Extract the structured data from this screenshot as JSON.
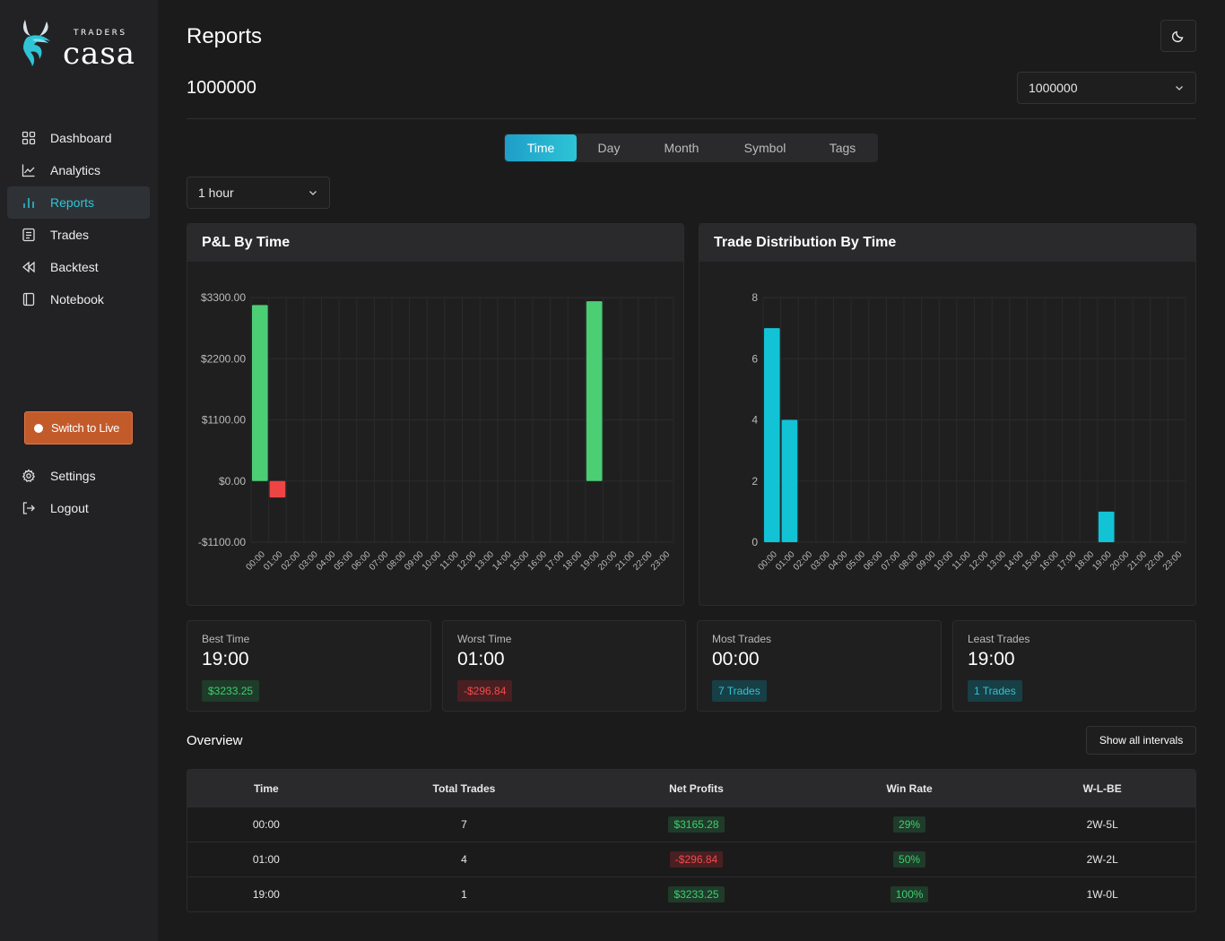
{
  "brand": {
    "traders": "TRADERS",
    "casa": "casa"
  },
  "sidebar": {
    "items": [
      {
        "label": "Dashboard",
        "icon": "dashboard-icon"
      },
      {
        "label": "Analytics",
        "icon": "analytics-icon"
      },
      {
        "label": "Reports",
        "icon": "reports-icon",
        "active": true
      },
      {
        "label": "Trades",
        "icon": "trades-icon"
      },
      {
        "label": "Backtest",
        "icon": "backtest-icon"
      },
      {
        "label": "Notebook",
        "icon": "notebook-icon"
      }
    ],
    "switch_label": "Switch to Live",
    "settings_label": "Settings",
    "logout_label": "Logout"
  },
  "header": {
    "title": "Reports",
    "account_title": "1000000",
    "account_select": "1000000"
  },
  "tabs": [
    "Time",
    "Day",
    "Month",
    "Symbol",
    "Tags"
  ],
  "interval_select": "1 hour",
  "pnl_chart_title": "P&L By Time",
  "dist_chart_title": "Trade Distribution By Time",
  "stats": [
    {
      "label": "Best Time",
      "value": "19:00",
      "badge": "$3233.25",
      "kind": "green"
    },
    {
      "label": "Worst Time",
      "value": "01:00",
      "badge": "-$296.84",
      "kind": "red"
    },
    {
      "label": "Most Trades",
      "value": "00:00",
      "badge": "7 Trades",
      "kind": "cyan"
    },
    {
      "label": "Least Trades",
      "value": "19:00",
      "badge": "1 Trades",
      "kind": "cyan"
    }
  ],
  "overview": {
    "title": "Overview",
    "show_all": "Show all intervals",
    "columns": [
      "Time",
      "Total Trades",
      "Net Profits",
      "Win Rate",
      "W-L-BE"
    ],
    "rows": [
      {
        "time": "00:00",
        "trades": "7",
        "profit": "$3165.28",
        "profit_kind": "green",
        "win": "29%",
        "wlbe": "2W-5L"
      },
      {
        "time": "01:00",
        "trades": "4",
        "profit": "-$296.84",
        "profit_kind": "red",
        "win": "50%",
        "wlbe": "2W-2L"
      },
      {
        "time": "19:00",
        "trades": "1",
        "profit": "$3233.25",
        "profit_kind": "green",
        "win": "100%",
        "wlbe": "1W-0L"
      }
    ]
  },
  "colors": {
    "accent": "#2ec4d6",
    "positive": "#4cce74",
    "negative": "#ef4444",
    "live": "#c35a2a"
  },
  "chart_data": [
    {
      "type": "bar",
      "title": "P&L By Time",
      "categories": [
        "00:00",
        "01:00",
        "02:00",
        "03:00",
        "04:00",
        "05:00",
        "06:00",
        "07:00",
        "08:00",
        "09:00",
        "10:00",
        "11:00",
        "12:00",
        "13:00",
        "14:00",
        "15:00",
        "16:00",
        "17:00",
        "18:00",
        "19:00",
        "20:00",
        "21:00",
        "22:00",
        "23:00"
      ],
      "values": [
        3165.28,
        -296.84,
        0,
        0,
        0,
        0,
        0,
        0,
        0,
        0,
        0,
        0,
        0,
        0,
        0,
        0,
        0,
        0,
        0,
        3233.25,
        0,
        0,
        0,
        0
      ],
      "yticks": [
        "$3300.00",
        "$2200.00",
        "$1100.00",
        "$0.00",
        "-$1100.00"
      ],
      "ylim": [
        -1100,
        3300
      ],
      "grid": true
    },
    {
      "type": "bar",
      "title": "Trade Distribution By Time",
      "categories": [
        "00:00",
        "01:00",
        "02:00",
        "03:00",
        "04:00",
        "05:00",
        "06:00",
        "07:00",
        "08:00",
        "09:00",
        "10:00",
        "11:00",
        "12:00",
        "13:00",
        "14:00",
        "15:00",
        "16:00",
        "17:00",
        "18:00",
        "19:00",
        "20:00",
        "21:00",
        "22:00",
        "23:00"
      ],
      "values": [
        7,
        4,
        0,
        0,
        0,
        0,
        0,
        0,
        0,
        0,
        0,
        0,
        0,
        0,
        0,
        0,
        0,
        0,
        0,
        1,
        0,
        0,
        0,
        0
      ],
      "yticks": [
        "8",
        "6",
        "4",
        "2",
        "0"
      ],
      "ylim": [
        0,
        8
      ],
      "grid": true
    }
  ]
}
